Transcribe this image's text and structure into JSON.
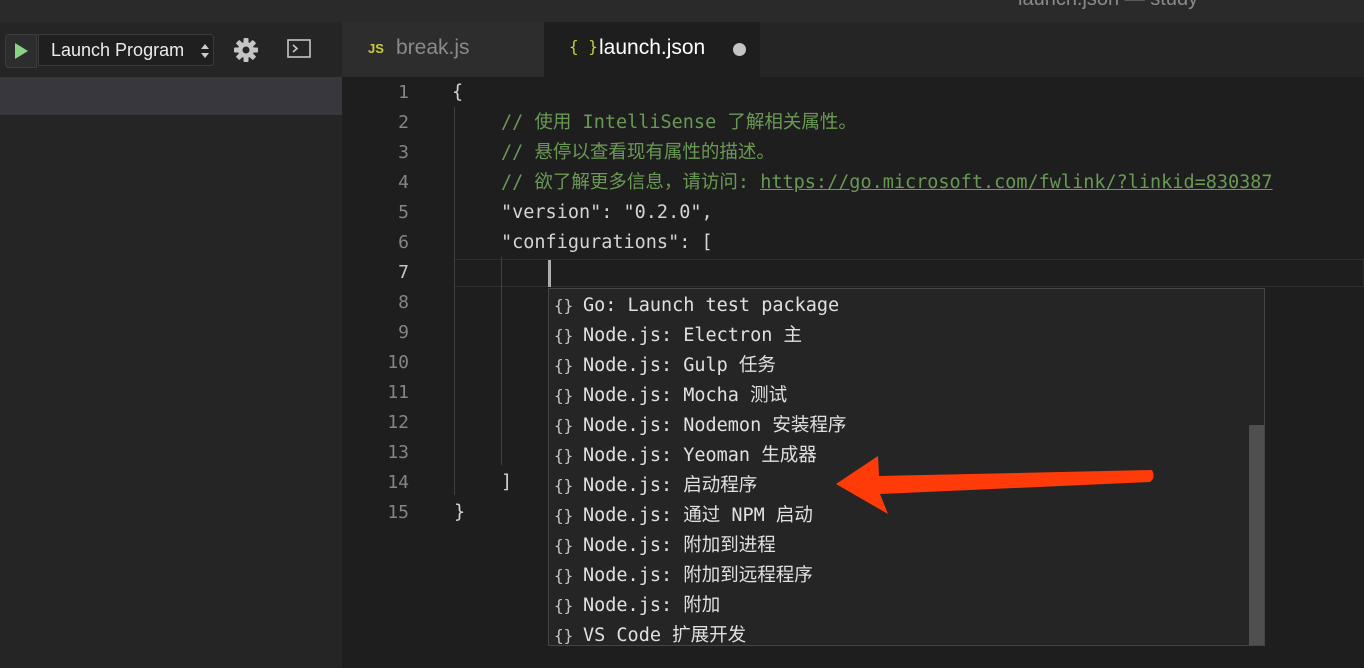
{
  "window": {
    "title": "launch.json — study"
  },
  "debug_toolbar": {
    "config_name": "Launch Program",
    "icons": {
      "start": "play-icon",
      "settings": "gear-icon",
      "console": "terminal-icon"
    }
  },
  "tabs": [
    {
      "icon_text": "JS",
      "label": "break.js",
      "active": false
    },
    {
      "icon_text": "{ }",
      "label": "launch.json",
      "active": true,
      "dirty": true
    }
  ],
  "editor": {
    "line_numbers": [
      "1",
      "2",
      "3",
      "4",
      "5",
      "6",
      "7",
      "8",
      "9",
      "10",
      "11",
      "12",
      "13",
      "14",
      "15"
    ],
    "active_line": "7",
    "lines": [
      {
        "text": "{"
      },
      {
        "comment": "// 使用 IntelliSense 了解相关属性。"
      },
      {
        "comment": "// 悬停以查看现有属性的描述。"
      },
      {
        "comment": "// 欲了解更多信息，请访问: ",
        "link": "https://go.microsoft.com/fwlink/?linkid=830387"
      },
      {
        "text": "\"version\": \"0.2.0\","
      },
      {
        "text": "\"configurations\": ["
      },
      {
        "text": ""
      },
      {
        "text": ""
      },
      {
        "text": ""
      },
      {
        "text": ""
      },
      {
        "text": ""
      },
      {
        "text": ""
      },
      {
        "text": ""
      },
      {
        "text": "]"
      },
      {
        "text": "}"
      }
    ]
  },
  "suggestions": {
    "icon": "{}",
    "items": [
      "Go: Launch test package",
      "Node.js: Electron 主",
      "Node.js: Gulp 任务",
      "Node.js: Mocha 测试",
      "Node.js: Nodemon 安装程序",
      "Node.js: Yeoman 生成器",
      "Node.js: 启动程序",
      "Node.js: 通过 NPM 启动",
      "Node.js: 附加到进程",
      "Node.js: 附加到远程程序",
      "Node.js: 附加",
      "VS Code 扩展开发"
    ]
  },
  "annotation": {
    "color": "#ff3b0a",
    "points_to_item": "Node.js: 启动程序"
  },
  "colors": {
    "comment": "#6a9955",
    "background": "#1e1e1e",
    "sidebar": "#252526"
  }
}
